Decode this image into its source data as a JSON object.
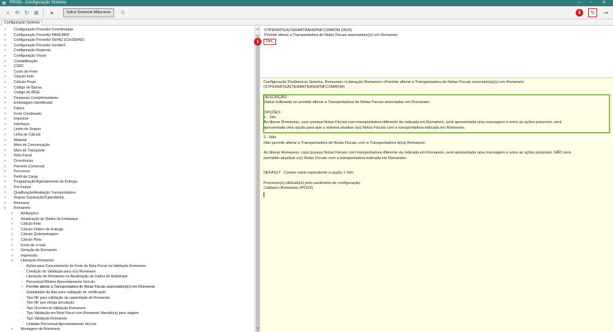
{
  "window": {
    "title": "P0033 - Configuração Sistema"
  },
  "toolbar": {
    "mask_button_label": "Salva Somente Máscaras",
    "badge_2": "2"
  },
  "tabs": [
    {
      "label": "Configuração Sistema"
    }
  ],
  "tree": {
    "items": [
      {
        "label": "Configuração Provedor Coordenadas",
        "level": 1,
        "expander": ">"
      },
      {
        "label": "Configuração Provedor PAMCARD",
        "level": 1,
        "expander": ">"
      },
      {
        "label": "Configuração Provedor SEFAZ (ConSEFAZ)",
        "level": 1,
        "expander": ">"
      },
      {
        "label": "Configuração Provedor SenderX",
        "level": 1,
        "expander": ">"
      },
      {
        "label": "Configuração Regional",
        "level": 1,
        "expander": ">"
      },
      {
        "label": "Configuração Visual",
        "level": 1,
        "expander": ">"
      },
      {
        "label": "Contabilização",
        "level": 1,
        "expander": ">"
      },
      {
        "label": "CSRC",
        "level": 1,
        "expander": ">"
      },
      {
        "label": "Custo de Frete",
        "level": 1,
        "expander": ">"
      },
      {
        "label": "Cálculo frete",
        "level": 1,
        "expander": ">"
      },
      {
        "label": "Cálculo Prazo",
        "level": 1,
        "expander": ">"
      },
      {
        "label": "Código de Barras",
        "level": 1,
        "expander": ">"
      },
      {
        "label": "Código do IBGE",
        "level": 1,
        "expander": ">"
      },
      {
        "label": "Despesas Complementares",
        "level": 1,
        "expander": ">"
      },
      {
        "label": "Embalagem Identificada",
        "level": 1,
        "expander": ">"
      },
      {
        "label": "Fatura",
        "level": 1,
        "expander": ">"
      },
      {
        "label": "Frete Combinado",
        "level": 1,
        "expander": ">"
      },
      {
        "label": "Impostos",
        "level": 1,
        "expander": ">"
      },
      {
        "label": "Interfaces",
        "level": 1,
        "expander": ">"
      },
      {
        "label": "Limite de Seguro",
        "level": 1,
        "expander": ">"
      },
      {
        "label": "Linha de Cálculo",
        "level": 1,
        "expander": ">"
      },
      {
        "label": "Material",
        "level": 1,
        "expander": ">"
      },
      {
        "label": "Meio de Comunicação",
        "level": 1,
        "expander": ">"
      },
      {
        "label": "Meio de Transporte",
        "level": 1,
        "expander": ">"
      },
      {
        "label": "Nota Fiscal",
        "level": 1,
        "expander": ">"
      },
      {
        "label": "Ocorrências",
        "level": 1,
        "expander": ">"
      },
      {
        "label": "Parceiro Comercial",
        "level": 1,
        "expander": ">"
      },
      {
        "label": "Percursos",
        "level": 1,
        "expander": ">"
      },
      {
        "label": "Perfil de Carga",
        "level": 1,
        "expander": ">"
      },
      {
        "label": "Programação/Agendamento de Entrega",
        "level": 1,
        "expander": ">"
      },
      {
        "label": "Pré Fatura",
        "level": 1,
        "expander": ">"
      },
      {
        "label": "Qualificação/Avaliação Transportadora",
        "level": 1,
        "expander": ">"
      },
      {
        "label": "Regras Separação/Calendários",
        "level": 1,
        "expander": ">"
      },
      {
        "label": "Remessa",
        "level": 1,
        "expander": ">"
      },
      {
        "label": "Romaneio",
        "level": 1,
        "expander": "v"
      },
      {
        "label": "Atribuições",
        "level": 2,
        "expander": ">"
      },
      {
        "label": "Atualização de Dados de Embarque",
        "level": 2,
        "expander": ">"
      },
      {
        "label": "Cálculo frete",
        "level": 2,
        "expander": ">"
      },
      {
        "label": "Cálculo Ordem de Entrega",
        "level": 2,
        "expander": ">"
      },
      {
        "label": "Cálculo Quilometragem",
        "level": 2,
        "expander": ">"
      },
      {
        "label": "Cálculo Rota",
        "level": 2,
        "expander": ">"
      },
      {
        "label": "Envio de e-mail",
        "level": 2,
        "expander": ">"
      },
      {
        "label": "Geração de Romaneio",
        "level": 2,
        "expander": ">"
      },
      {
        "label": "Impressão",
        "level": 2,
        "expander": ">"
      },
      {
        "label": "Liberação Romaneio",
        "level": 2,
        "expander": "v"
      },
      {
        "label": "Ações para Cancelamento de Frete de Nota Fiscal na Validação Romaneio",
        "level": 3,
        "expander": ""
      },
      {
        "label": "Condição de Validação para o(s) Romaneio",
        "level": 3,
        "expander": ""
      },
      {
        "label": "Liberação de Romaneio na Atualização de Dados de Embarque",
        "level": 3,
        "expander": ""
      },
      {
        "label": "Percentual Mínimo Aproveitamento Veículo",
        "level": 3,
        "expander": ""
      },
      {
        "label": "Permite alterar a Transportadora de Notas Fiscais associado(a)(s) em Romaneio",
        "level": 3,
        "expander": "",
        "selected": true
      },
      {
        "label": "Quantidade de dias para validação de certificação",
        "level": 3,
        "expander": ""
      },
      {
        "label": "Tipo NF para validação da capacidade de Romaneio",
        "level": 3,
        "expander": ""
      },
      {
        "label": "Tipo NF que obriga simulação",
        "level": 3,
        "expander": ""
      },
      {
        "label": "Tipo Ocorrência Validação Romaneio",
        "level": 3,
        "expander": ""
      },
      {
        "label": "Tipo Validação em Nota Fiscal com Romaneio liberado(a) para viagem",
        "level": 3,
        "expander": ""
      },
      {
        "label": "Tipo Validação Romaneio",
        "level": 3,
        "expander": ""
      },
      {
        "label": "Unidade Percentual Aproveitamento Veículo",
        "level": 3,
        "expander": ""
      },
      {
        "label": "Montagem de Romaneio",
        "level": 2,
        "expander": ">"
      },
      {
        "label": "Validações",
        "level": 2,
        "expander": ">"
      }
    ]
  },
  "param": {
    "name": "STPERMITEALTERARTRANSPNFCOMROM (0625)",
    "label": "Permite alterar a Transportadora de Notas Fiscais associado(a)(s) em Romaneio",
    "value": "Sim",
    "badge_1": "1"
  },
  "description": {
    "lines": [
      "Configuração Parâmetros Sistema: Romaneio->Liberação Romaneio->Permite alterar a Transportadora de Notas Fiscais associado(a)(s) em Romaneio",
      "(STPERMITEALTERARTRANSPNFCOMROM)",
      "",
      "DESCRIÇÃO :",
      "Status indicando se permite alterar a Transportadora de Notas Fiscais associadas em Romaneio.",
      "",
      "OPÇÕES :",
      "1 - Sim",
      "Ao liberar Romaneio, caso  possua Notas Fiscais com transportadora diferente da indicada em Romaneio, será apresentada uma mensagem e entre as ações possíveis, será",
      "apresentada uma opção para que o sistema atualize o(s) Notas Fiscais com a transportadora indicada em Romaneio.",
      "",
      "2 - Não",
      "Não permite alterar a Transportadora de Notas Fiscais com a Transportadora do(a) Romaneio.",
      "",
      "Ao liberar Romaneio, caso  possua Notas Fiscais com transportadora diferente da indicada em Romaneio, será apresentada uma mensagem e entre as ações possíveis, NÃO será",
      "permitido atualizar o(s) Notas Fiscais com a transportadora indicada em Romaneio.",
      "",
      "",
      "DEFAULT : Campo vazio equivalente a opção 1-Sim",
      "",
      "Processo(s) utilizado(s) pelo parâmetro de configuração:",
      "Cadastro-Romaneio (P0102)"
    ]
  }
}
